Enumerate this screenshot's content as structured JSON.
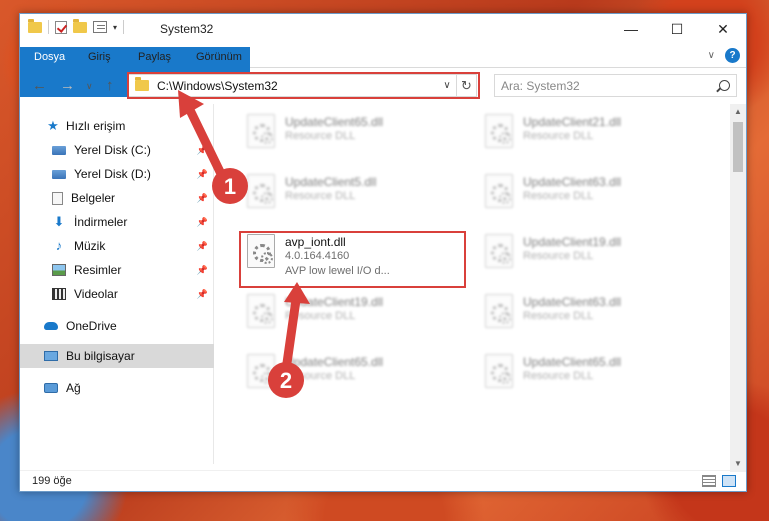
{
  "window": {
    "title": "System32",
    "controls": {
      "minimize": "—",
      "maximize": "☐",
      "close": "✕"
    }
  },
  "ribbon": {
    "tabs": [
      "Dosya",
      "Giriş",
      "Paylaş",
      "Görünüm"
    ],
    "expand_caret": "∨",
    "help": "?"
  },
  "nav": {
    "back": "←",
    "forward": "→",
    "recent": "∨",
    "up": "↑",
    "address": "C:\\Windows\\System32",
    "address_caret": "∨",
    "refresh": "↻",
    "search_placeholder": "Ara: System32"
  },
  "sidebar": {
    "items": [
      {
        "label": "Hızlı erişim",
        "icon": "star-icon",
        "pinned": false
      },
      {
        "label": "Yerel Disk (C:)",
        "icon": "drive-icon",
        "pinned": true
      },
      {
        "label": "Yerel Disk (D:)",
        "icon": "drive-icon",
        "pinned": true
      },
      {
        "label": "Belgeler",
        "icon": "document-icon",
        "pinned": true
      },
      {
        "label": "İndirmeler",
        "icon": "download-icon",
        "pinned": true
      },
      {
        "label": "Müzik",
        "icon": "music-icon",
        "pinned": true
      },
      {
        "label": "Resimler",
        "icon": "pictures-icon",
        "pinned": true
      },
      {
        "label": "Videolar",
        "icon": "video-icon",
        "pinned": true
      },
      {
        "label": "OneDrive",
        "icon": "cloud-icon",
        "pinned": false
      },
      {
        "label": "Bu bilgisayar",
        "icon": "computer-icon",
        "pinned": false
      },
      {
        "label": "Ağ",
        "icon": "network-icon",
        "pinned": false
      }
    ],
    "pin_glyph": "📌"
  },
  "files": {
    "left": [
      {
        "name": "UpdateClient65.dll",
        "desc": "Resource DLL"
      },
      {
        "name": "UpdateClient5.dll",
        "desc": "Resource DLL"
      },
      {
        "name": "avp_iont.dll",
        "version": "4.0.164.4160",
        "desc": "AVP low lewel I/O d..."
      },
      {
        "name": "UpdateClient19.dll",
        "desc": "Resource DLL"
      },
      {
        "name": "UpdateClient65.dll",
        "desc": "Resource DLL"
      }
    ],
    "right": [
      {
        "name": "UpdateClient21.dll",
        "desc": "Resource DLL"
      },
      {
        "name": "UpdateClient63.dll",
        "desc": "Resource DLL"
      },
      {
        "name": "UpdateClient19.dll",
        "desc": "Resource DLL"
      },
      {
        "name": "UpdateClient63.dll",
        "desc": "Resource DLL"
      },
      {
        "name": "UpdateClient65.dll",
        "desc": "Resource DLL"
      }
    ]
  },
  "status": {
    "count": "199 öğe"
  },
  "annotations": {
    "marker1": "1",
    "marker2": "2",
    "color": "#d9403b"
  }
}
